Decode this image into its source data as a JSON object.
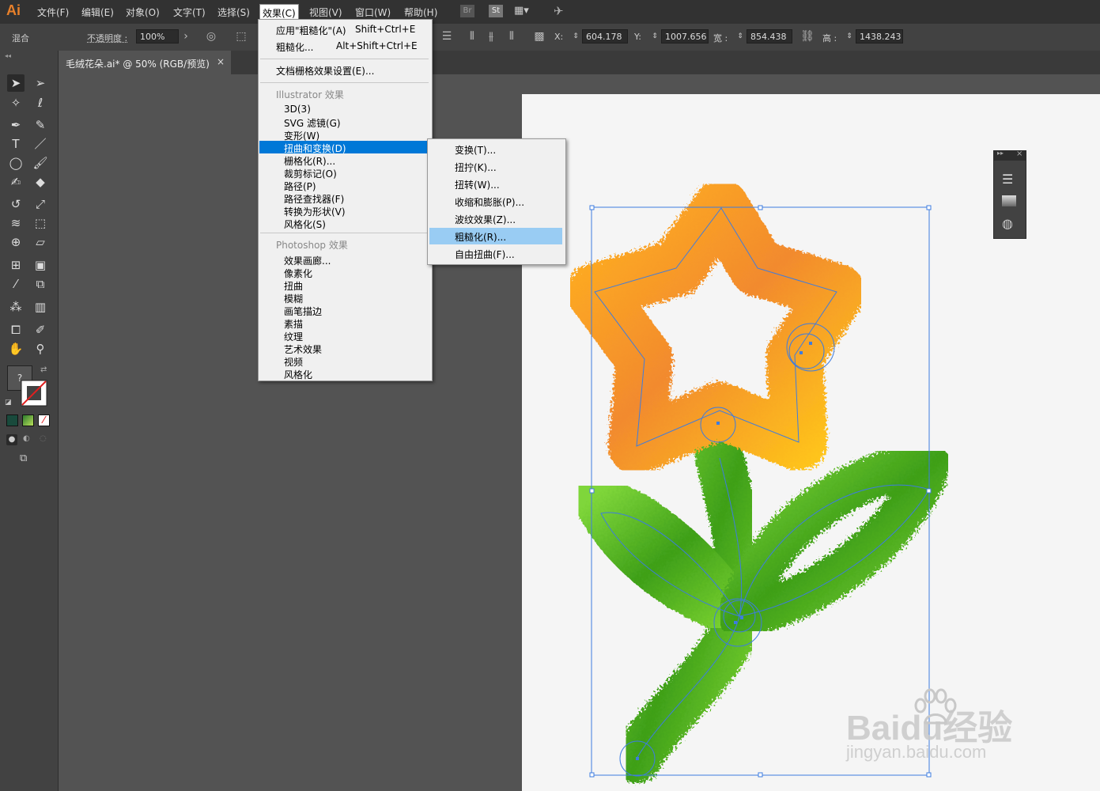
{
  "app": {
    "logo": "Ai"
  },
  "menubar": {
    "items": [
      "文件(F)",
      "编辑(E)",
      "对象(O)",
      "文字(T)",
      "选择(S)",
      "效果(C)",
      "视图(V)",
      "窗口(W)",
      "帮助(H)"
    ],
    "bridge": "Br",
    "stock": "St"
  },
  "controlbar": {
    "blend_label": "混合",
    "opacity_label": "不透明度 :",
    "opacity_value": "100%",
    "x_label": "X:",
    "x_value": "604.178",
    "y_label": "Y:",
    "y_value": "1007.656",
    "w_label": "宽 :",
    "w_value": "854.438",
    "h_label": "高 :",
    "h_value": "1438.243"
  },
  "document_tab": {
    "title": "毛绒花朵.ai* @ 50% (RGB/预览)",
    "close": "×"
  },
  "effect_menu": {
    "apply_label": "应用\"粗糙化\"(A)",
    "apply_shortcut": "Shift+Ctrl+E",
    "last_label": "粗糙化...",
    "last_shortcut": "Alt+Shift+Ctrl+E",
    "raster_settings": "文档栅格效果设置(E)...",
    "illustrator_header": "Illustrator 效果",
    "illustrator_items": [
      "3D(3)",
      "SVG 滤镜(G)",
      "变形(W)",
      "扭曲和变换(D)",
      "栅格化(R)...",
      "裁剪标记(O)",
      "路径(P)",
      "路径查找器(F)",
      "转换为形状(V)",
      "风格化(S)"
    ],
    "photoshop_header": "Photoshop 效果",
    "photoshop_items": [
      "效果画廊...",
      "像素化",
      "扭曲",
      "模糊",
      "画笔描边",
      "素描",
      "纹理",
      "艺术效果",
      "视频",
      "风格化"
    ]
  },
  "distort_submenu": {
    "items": [
      "变换(T)...",
      "扭拧(K)...",
      "扭转(W)...",
      "收缩和膨胀(P)...",
      "波纹效果(Z)...",
      "粗糙化(R)...",
      "自由扭曲(F)..."
    ]
  },
  "watermark": {
    "brand": "Baidu经验",
    "url": "jingyan.baidu.com"
  },
  "toolbox": {
    "unknown": "?"
  },
  "colors": {
    "accent": "#0078d7",
    "hover": "#99ccf3",
    "flower_orange": "#f28a2e",
    "flower_yellow": "#ffc21a",
    "leaf_green": "#4cb81a",
    "selection": "#3d7ce0"
  }
}
